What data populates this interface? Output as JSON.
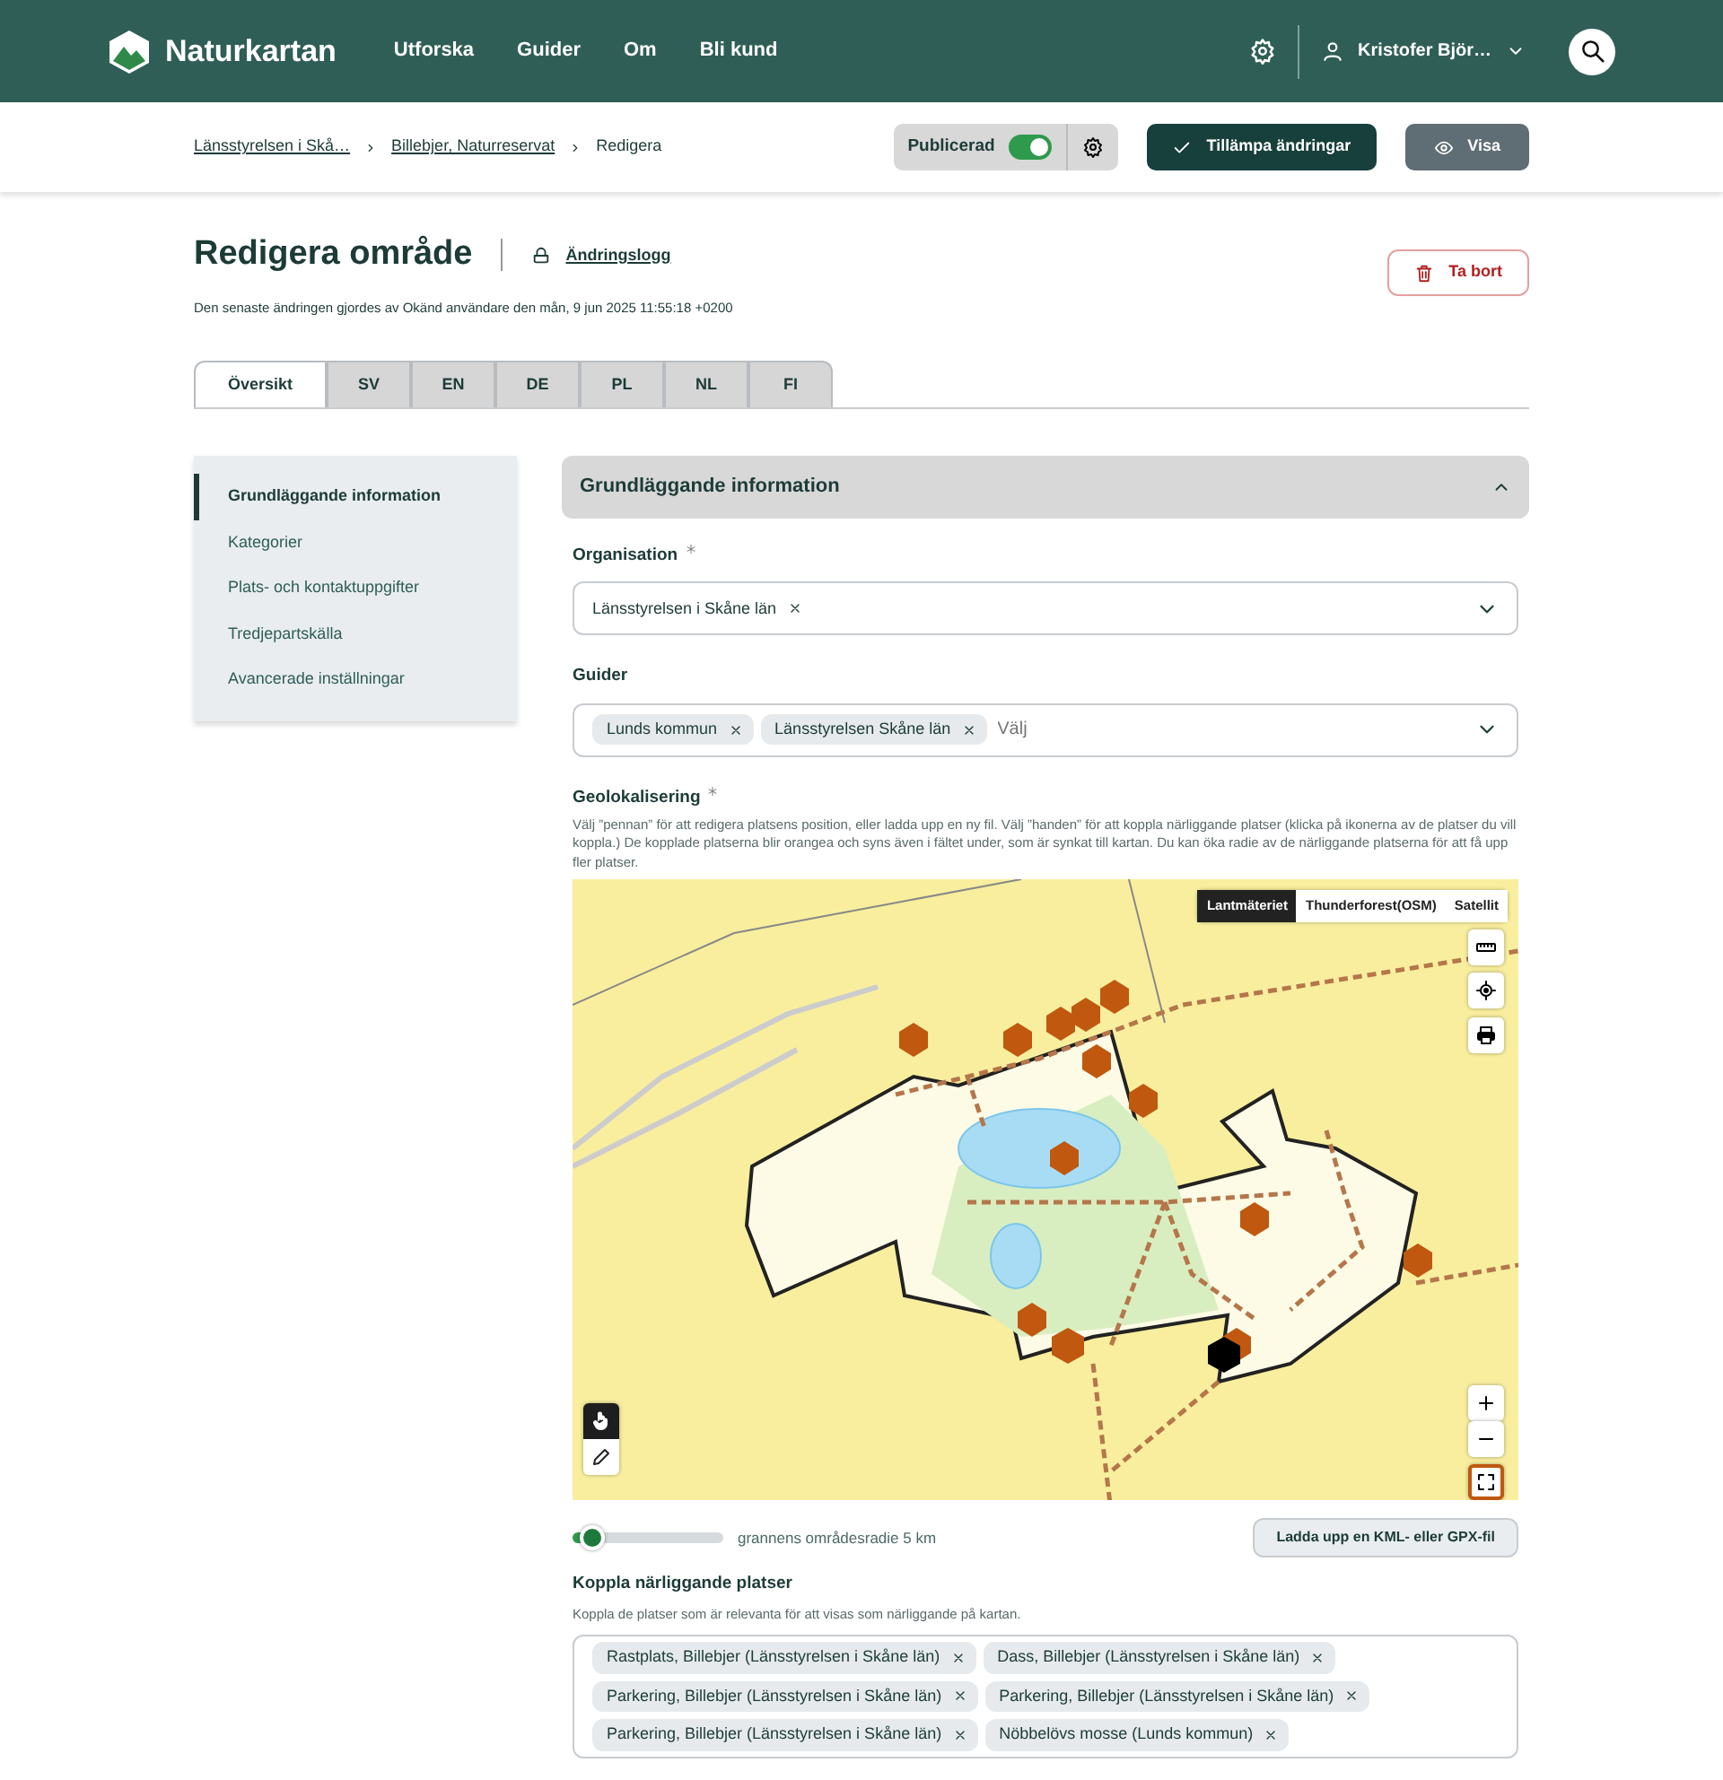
{
  "brand": "Naturkartan",
  "nav": [
    {
      "label": "Utforska"
    },
    {
      "label": "Guider"
    },
    {
      "label": "Om"
    },
    {
      "label": "Bli kund"
    }
  ],
  "user": {
    "name": "Kristofer Björ…"
  },
  "breadcrumbs": [
    {
      "label": "Länsstyrelsen i Skå…",
      "link": true
    },
    {
      "label": "Billebjer, Naturreservat",
      "link": true
    },
    {
      "label": "Redigera",
      "link": false
    }
  ],
  "publish": {
    "label": "Publicerad",
    "on": true
  },
  "apply_button": "Tillämpa ändringar",
  "view_button": "Visa",
  "page": {
    "title": "Redigera område",
    "changelog": "Ändringslogg",
    "meta": "Den senaste ändringen gjordes av Okänd användare den mån, 9 jun 2025 11:55:18 +0200",
    "delete_button": "Ta bort"
  },
  "tabs": [
    {
      "label": "Översikt",
      "selected": true
    },
    {
      "label": "SV",
      "selected": false
    },
    {
      "label": "EN",
      "selected": false
    },
    {
      "label": "DE",
      "selected": false
    },
    {
      "label": "PL",
      "selected": false
    },
    {
      "label": "NL",
      "selected": false
    },
    {
      "label": "FI",
      "selected": false
    }
  ],
  "sidebar": {
    "items": [
      {
        "label": "Grundläggande information",
        "selected": true
      },
      {
        "label": "Kategorier",
        "selected": false
      },
      {
        "label": "Plats- och kontaktuppgifter",
        "selected": false
      },
      {
        "label": "Tredjepartskälla",
        "selected": false
      },
      {
        "label": "Avancerade inställningar",
        "selected": false
      }
    ]
  },
  "section": {
    "title": "Grundläggande information",
    "expanded": true
  },
  "organisation": {
    "label": "Organisation",
    "required": true,
    "tags": [
      "Länsstyrelsen i Skåne län"
    ]
  },
  "guides": {
    "label": "Guider",
    "tags": [
      "Lunds kommun",
      "Länsstyrelsen Skåne län"
    ],
    "placeholder": "Välj"
  },
  "geo": {
    "label": "Geolokalisering",
    "required": true,
    "help": "Välj ”pennan” för att redigera platsens position, eller ladda upp en ny fil. Välj ”handen” för att koppla närliggande platser (klicka på ikonerna av de platser du vill koppla.) De kopplade platserna blir orangea och syns även i fältet under, som är synkat till kartan. Du kan öka radie av de närliggande platserna för att få upp fler platser.",
    "layers": [
      {
        "label": "Lantmäteriet",
        "selected": true
      },
      {
        "label": "Thunderforest(OSM)",
        "selected": false
      },
      {
        "label": "Satellit",
        "selected": false
      }
    ],
    "tools": [
      {
        "kind": "hand",
        "selected": true
      },
      {
        "kind": "pencil",
        "selected": false
      }
    ],
    "radius": {
      "level": 0.13,
      "reading": "grannens områdesradie 5 km"
    },
    "upload_button": "Ladda upp en KML- eller GPX-fil"
  },
  "nearby": {
    "label": "Koppla närliggande platser",
    "help": "Koppla de platser som är relevanta för att visas som närliggande på kartan.",
    "tags": [
      "Rastplats, Billebjer (Länsstyrelsen i Skåne län)",
      "Dass, Billebjer (Länsstyrelsen i Skåne län)",
      "Parkering, Billebjer (Länsstyrelsen i Skåne län)",
      "Parkering, Billebjer (Länsstyrelsen i Skåne län)",
      "Parkering, Billebjer (Länsstyrelsen i Skåne län)",
      "Nöbbelövs mosse (Lunds kommun)"
    ]
  }
}
